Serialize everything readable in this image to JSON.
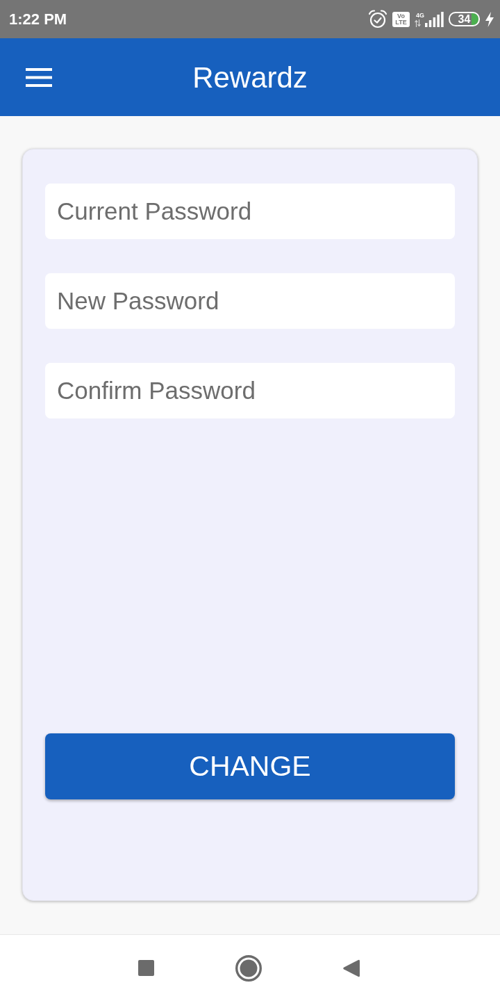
{
  "status_bar": {
    "time": "1:22 PM",
    "volte": [
      "Vo",
      "LTE"
    ],
    "network": "4G",
    "battery": "34",
    "charging": true
  },
  "app_bar": {
    "title": "Rewardz"
  },
  "form": {
    "fields": [
      {
        "placeholder": "Current Password"
      },
      {
        "placeholder": "New Password"
      },
      {
        "placeholder": "Confirm Password"
      }
    ],
    "submit_button": "CHANGE"
  }
}
